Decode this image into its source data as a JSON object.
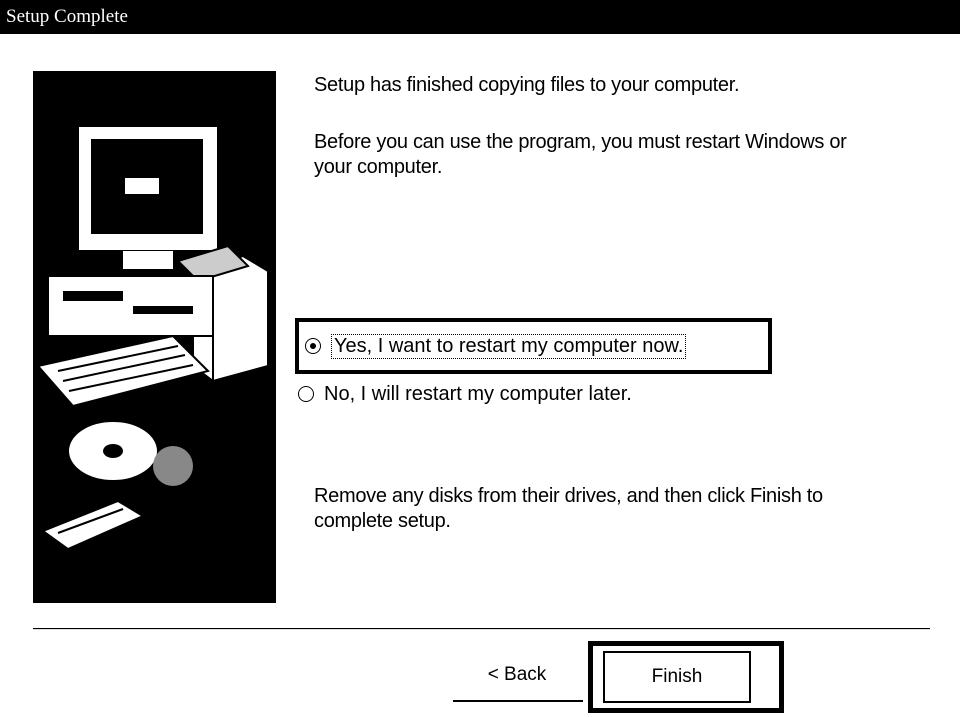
{
  "window": {
    "title": "Setup Complete"
  },
  "messages": {
    "line1": "Setup has finished copying files to your computer.",
    "line2": "Before you can use the program, you must restart Windows or",
    "line3": "your computer.",
    "line4": "Remove any disks from their drives, and then click Finish to",
    "line5": "complete setup."
  },
  "options": [
    {
      "label": "Yes, I want to restart my computer now.",
      "selected": true
    },
    {
      "label": "No, I will restart my computer later.",
      "selected": false
    }
  ],
  "buttons": {
    "back_label": "< Back",
    "finish_label": "Finish"
  },
  "icons": {
    "illustration": "computer-and-cd-illustration"
  }
}
